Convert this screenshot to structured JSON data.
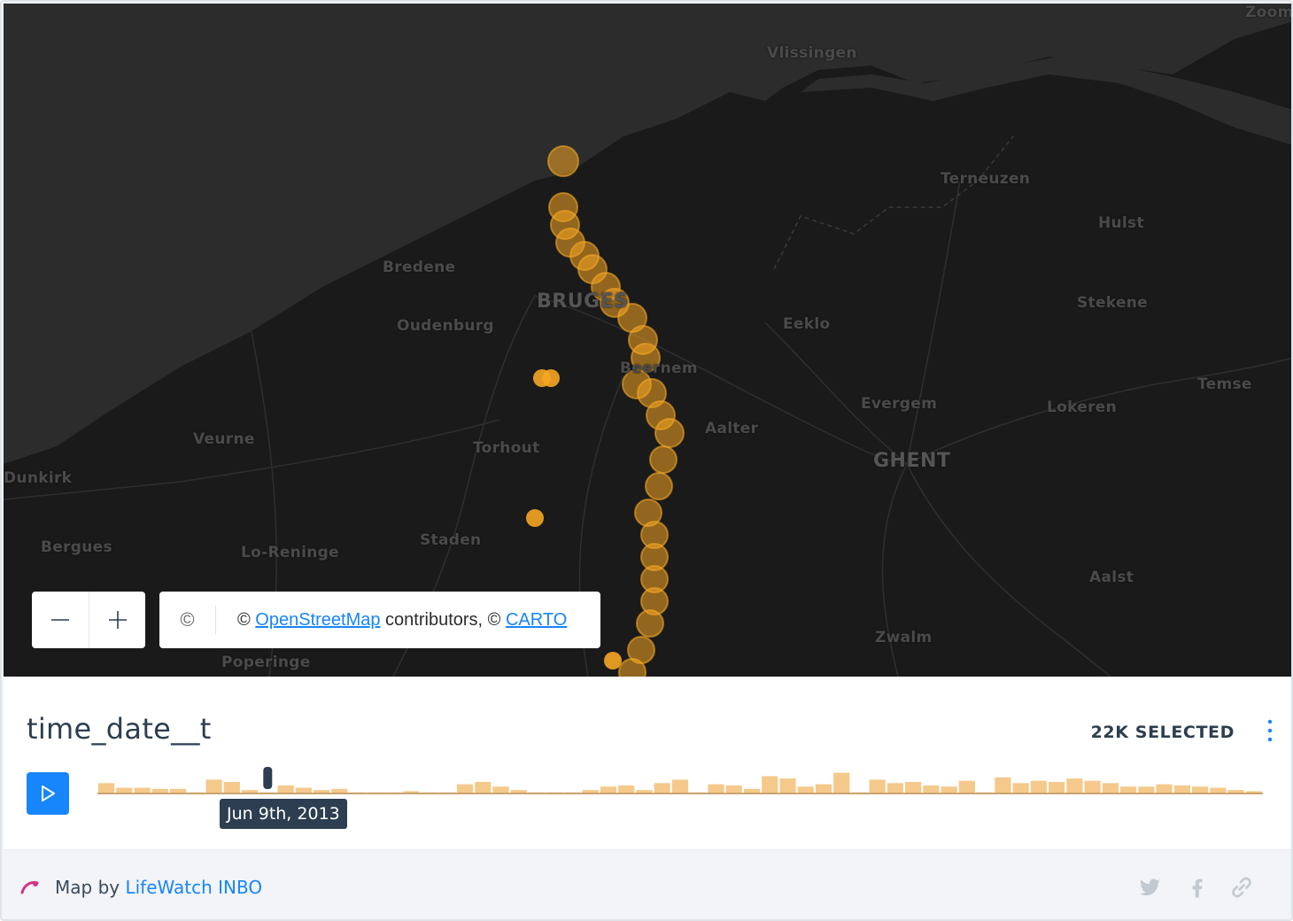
{
  "map": {
    "places": [
      {
        "name": "Vlissingen",
        "big": false
      },
      {
        "name": "Terneuzen",
        "big": false
      },
      {
        "name": "Hulst",
        "big": false
      },
      {
        "name": "Stekene",
        "big": false
      },
      {
        "name": "Bredene",
        "big": false
      },
      {
        "name": "BRUGES",
        "big": true
      },
      {
        "name": "Oudenburg",
        "big": false
      },
      {
        "name": "Eeklo",
        "big": false
      },
      {
        "name": "Beernem",
        "big": false
      },
      {
        "name": "Evergem",
        "big": false
      },
      {
        "name": "Lokeren",
        "big": false
      },
      {
        "name": "Temse",
        "big": false
      },
      {
        "name": "Veurne",
        "big": false
      },
      {
        "name": "Torhout",
        "big": false
      },
      {
        "name": "Aalter",
        "big": false
      },
      {
        "name": "GHENT",
        "big": true
      },
      {
        "name": "Dunkirk",
        "big": false
      },
      {
        "name": "Bergues",
        "big": false
      },
      {
        "name": "Lo-Reninge",
        "big": false
      },
      {
        "name": "Staden",
        "big": false
      },
      {
        "name": "Aalst",
        "big": false
      },
      {
        "name": "Zwalm",
        "big": false
      },
      {
        "name": "Poperinge",
        "big": false
      },
      {
        "name": "Zoom",
        "big": false
      }
    ],
    "colors": {
      "land": "#1a1a1a",
      "water": "#2c2c2c",
      "points": "#f5a623"
    },
    "zoom_in_icon": "plus-icon",
    "zoom_out_icon": "minus-icon",
    "attribution": {
      "icon": "copyright-icon",
      "icon_glyph": "©",
      "prefix": "© ",
      "osm_link": "OpenStreetMap",
      "middle": " contributors, © ",
      "carto_link": "CARTO"
    }
  },
  "widget": {
    "title": "time_date__t",
    "selected": "22K SELECTED",
    "tooltip": "Jun 9th, 2013",
    "play_icon": "play-icon",
    "more_icon": "more-vertical-icon",
    "bar_color": "#f5c98b",
    "histogram": [
      9,
      5,
      5,
      4,
      4,
      1,
      12,
      10,
      3,
      1,
      7,
      5,
      3,
      4,
      1,
      1,
      1,
      2,
      1,
      1,
      8,
      10,
      6,
      3,
      1,
      1,
      1,
      3,
      6,
      7,
      3,
      9,
      12,
      1,
      8,
      7,
      4,
      15,
      13,
      6,
      8,
      18,
      1,
      12,
      9,
      10,
      7,
      6,
      11,
      1,
      14,
      9,
      11,
      10,
      13,
      11,
      9,
      6,
      6,
      8,
      7,
      6,
      5,
      3,
      2
    ],
    "histogram_max": 20,
    "tooltip_bar_index": 9
  },
  "footer": {
    "prefix": "Map by ",
    "author": "LifeWatch INBO",
    "logo_icon": "carto-logo-icon",
    "social": [
      "twitter-icon",
      "facebook-icon",
      "link-icon"
    ]
  }
}
